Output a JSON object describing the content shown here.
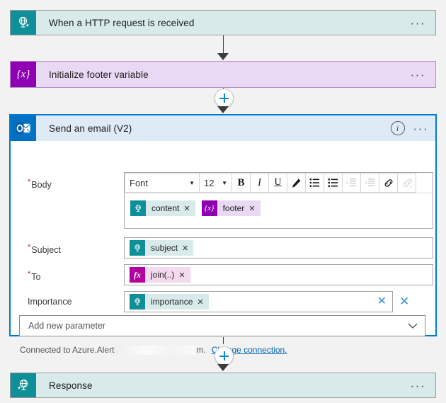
{
  "flow": {
    "trigger": {
      "title": "When a HTTP request is received",
      "icon": "http-request-icon",
      "menu": "···",
      "accent": "#0f9099",
      "background": "#d8eaea"
    },
    "variable": {
      "title": "Initialize footer variable",
      "icon": "variable-icon",
      "icon_glyph": "{x}",
      "menu": "···",
      "accent": "#8f00b3",
      "background": "#e9d9f5"
    },
    "email": {
      "title": "Send an email (V2)",
      "icon": "outlook-icon",
      "menu": "···",
      "info": "i",
      "accent": "#0072c6",
      "header_background": "#deeaf6",
      "selection_color": "#0078d4"
    },
    "response": {
      "title": "Response",
      "icon": "http-response-icon",
      "menu": "···",
      "accent": "#0f9099",
      "background": "#d8eaea"
    },
    "add_step_button": "+"
  },
  "email_form": {
    "fields": {
      "body": {
        "label": "Body",
        "required": true,
        "required_mark": "*"
      },
      "subject": {
        "label": "Subject",
        "required": true,
        "required_mark": "*"
      },
      "to": {
        "label": "To",
        "required": true,
        "required_mark": "*"
      },
      "importance": {
        "label": "Importance",
        "required": false,
        "required_mark": ""
      }
    },
    "toolbar": {
      "font_name": "Font",
      "font_size": "12",
      "caret": "▼",
      "buttons": [
        {
          "name": "bold-button",
          "label": "B",
          "disabled": false
        },
        {
          "name": "italic-button",
          "label": "I",
          "disabled": false
        },
        {
          "name": "underline-button",
          "label": "U",
          "disabled": false
        },
        {
          "name": "text-color-button",
          "label": "pen-icon",
          "disabled": false
        },
        {
          "name": "numbered-list-button",
          "label": "numbered-list-icon",
          "disabled": false
        },
        {
          "name": "bulleted-list-button",
          "label": "bulleted-list-icon",
          "disabled": false
        },
        {
          "name": "indent-button",
          "label": "indent-icon",
          "disabled": true
        },
        {
          "name": "outdent-button",
          "label": "outdent-icon",
          "disabled": true
        },
        {
          "name": "insert-link-button",
          "label": "link-icon",
          "disabled": false
        },
        {
          "name": "remove-link-button",
          "label": "unlink-icon",
          "disabled": true
        }
      ]
    },
    "body_tokens": [
      {
        "text": "content",
        "kind": "teal",
        "icon": "http-request-icon",
        "remove": "✕"
      },
      {
        "text": "footer",
        "kind": "purple",
        "icon": "variable-icon",
        "icon_glyph": "{x}",
        "remove": "✕"
      }
    ],
    "subject_token": {
      "text": "subject",
      "kind": "teal",
      "icon": "http-request-icon",
      "remove": "✕"
    },
    "to_token": {
      "text": "join(..)",
      "kind": "magenta",
      "icon": "function-icon",
      "icon_glyph": "fx",
      "remove": "✕"
    },
    "importance_token": {
      "text": "importance",
      "kind": "teal",
      "icon": "http-request-icon",
      "remove": "✕"
    },
    "importance_clear": "✕",
    "importance_remove_parameter": "✕",
    "add_new_parameter": {
      "label": "Add new parameter",
      "chevron": "⌄"
    },
    "connection": {
      "prefix": "Connected to Azure.Alert",
      "redacted": "",
      "suffix": "m.",
      "change_link": "Change connection."
    }
  }
}
